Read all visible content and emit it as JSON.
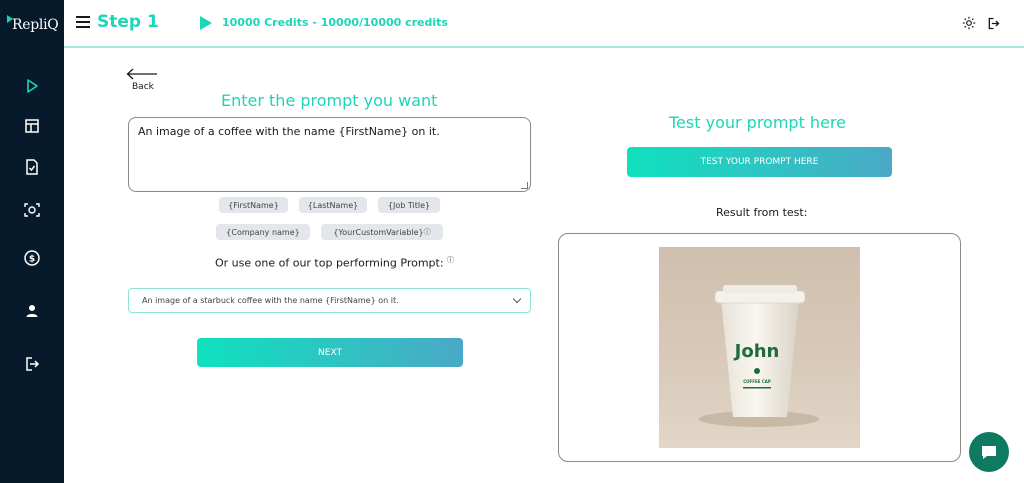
{
  "app": {
    "logo_text": "RepliQ",
    "brand_color": "#1cd6b7"
  },
  "sidebar": {
    "items": [
      {
        "icon": "play-icon"
      },
      {
        "icon": "layout-icon"
      },
      {
        "icon": "document-check-icon"
      },
      {
        "icon": "camera-scan-icon"
      },
      {
        "icon": "dollar-icon"
      },
      {
        "icon": "user-icon"
      },
      {
        "icon": "logout-icon"
      }
    ]
  },
  "header": {
    "title": "Step 1",
    "credits": "10000 Credits - 10000/10000 credits"
  },
  "left": {
    "back_label": "Back",
    "title": "Enter the prompt you want",
    "prompt_value": "An image of a coffee with the name {FirstName} on it.",
    "variables": [
      "{FirstName}",
      "{LastName}",
      "{Job Title}",
      "{Company name}",
      "{YourCustomVariable}"
    ],
    "top_prompt_label": "Or use one of our top performing Prompt:",
    "top_prompt_selected": "An image of a starbuck coffee with the name {FirstName} on it.",
    "next_label": "NEXT"
  },
  "right": {
    "title": "Test your prompt here",
    "test_button_label": "TEST YOUR PROMPT HERE",
    "result_label": "Result from test:",
    "result_image": {
      "cup_name": "John",
      "cup_brand": "COFFEE CAP"
    }
  }
}
